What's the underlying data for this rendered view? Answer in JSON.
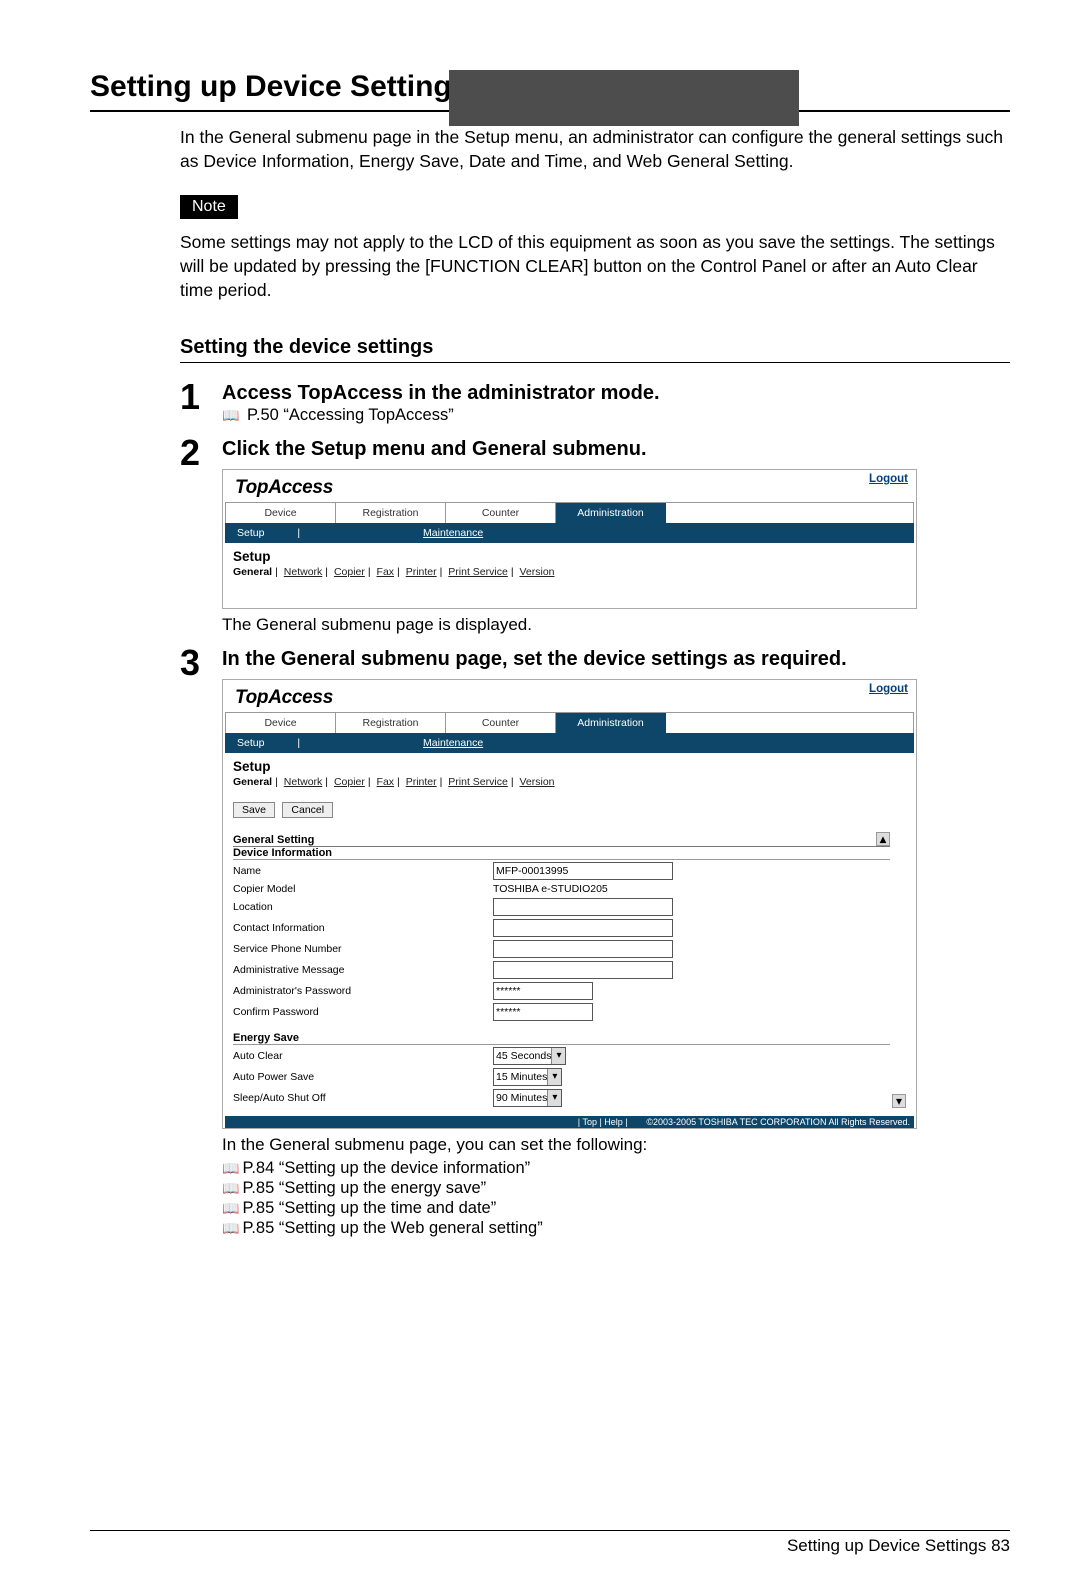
{
  "page": {
    "title": "Setting up Device Settings",
    "intro": "In the General submenu page in the Setup menu, an administrator can configure the general settings such as Device Information, Energy Save, Date and Time, and Web General Setting.",
    "note_label": "Note",
    "note_body": "Some settings may not apply to the LCD of this equipment as soon as you save the settings. The settings will be updated by pressing the [FUNCTION CLEAR] button on the Control Panel or after an Auto Clear time period.",
    "subhead": "Setting the device settings",
    "footer_text": "Setting up Device Settings    83"
  },
  "steps": {
    "s1_num": "1",
    "s1_title": "Access TopAccess in the administrator mode.",
    "s1_ref": "P.50 “Accessing TopAccess”",
    "s2_num": "2",
    "s2_title": "Click the Setup menu and General submenu.",
    "s2_desc": "The General submenu page is displayed.",
    "s3_num": "3",
    "s3_title": "In the General submenu page, set the device settings as required.",
    "s3_desc": "In the General submenu page, you can set the following:",
    "s3_refs": [
      "P.84 “Setting up the device information”",
      "P.85 “Setting up the energy save”",
      "P.85 “Setting up the time and date”",
      "P.85 “Setting up the Web general setting”"
    ]
  },
  "shot_common": {
    "logo": "TopAccess",
    "logout": "Logout",
    "tabs": [
      "Device",
      "Registration",
      "Counter",
      "Administration"
    ],
    "row2_setup": "Setup",
    "row2_maint": "Maintenance",
    "content_head": "Setup",
    "sublinks": [
      "General",
      "Network",
      "Copier",
      "Fax",
      "Printer",
      "Print Service",
      "Version"
    ]
  },
  "shot3": {
    "save_btn": "Save",
    "cancel_btn": "Cancel",
    "general_setting": "General Setting",
    "device_info": "Device Information",
    "fields": {
      "name_lbl": "Name",
      "name_val": "MFP-00013995",
      "model_lbl": "Copier Model",
      "model_val": "TOSHIBA e-STUDIO205",
      "location_lbl": "Location",
      "contact_lbl": "Contact Information",
      "service_lbl": "Service Phone Number",
      "admmsg_lbl": "Administrative Message",
      "admpwd_lbl": "Administrator's Password",
      "admpwd_val": "******",
      "confpwd_lbl": "Confirm Password",
      "confpwd_val": "******"
    },
    "energy_head": "Energy Save",
    "energy": {
      "autoclear_lbl": "Auto Clear",
      "autoclear_val": "45 Seconds",
      "autopower_lbl": "Auto Power Save",
      "autopower_val": "15 Minutes",
      "sleep_lbl": "Sleep/Auto Shut Off",
      "sleep_val": "90 Minutes"
    },
    "footer_links": "| Top | Help |",
    "footer_copy": "©2003-2005 TOSHIBA TEC CORPORATION All Rights Reserved."
  }
}
